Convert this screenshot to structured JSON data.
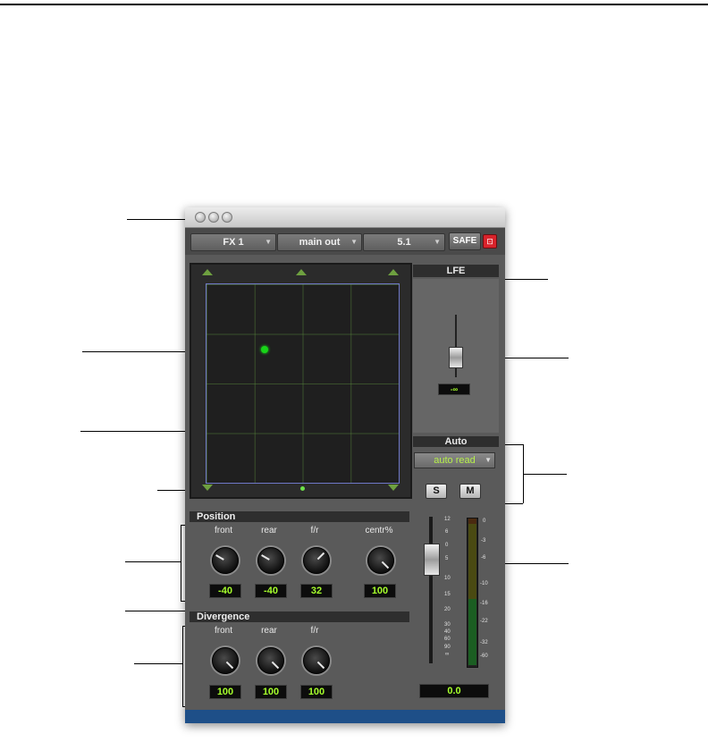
{
  "window": {
    "toolbar": {
      "insert_label": "FX 1",
      "output_label": "main out",
      "format_label": "5.1",
      "safe_label": "SAFE"
    },
    "lfe": {
      "header": "LFE",
      "value": "-∞"
    },
    "auto": {
      "header": "Auto",
      "mode": "auto read",
      "solo": "S",
      "mute": "M"
    },
    "position": {
      "header": "Position",
      "knobs": [
        {
          "label": "front",
          "value": "-40"
        },
        {
          "label": "rear",
          "value": "-40"
        },
        {
          "label": "f/r",
          "value": "32"
        },
        {
          "label": "centr%",
          "value": "100"
        }
      ]
    },
    "divergence": {
      "header": "Divergence",
      "knobs": [
        {
          "label": "front",
          "value": "100"
        },
        {
          "label": "rear",
          "value": "100"
        },
        {
          "label": "f/r",
          "value": "100"
        }
      ]
    },
    "fader": {
      "value": "0.0",
      "scale": [
        "12",
        "6",
        "0",
        "5",
        "10",
        "15",
        "20",
        "30",
        "40",
        "60",
        "90",
        "∞"
      ]
    },
    "meter": {
      "scale": [
        "0",
        "-3",
        "-6",
        "-10",
        "-16",
        "-22",
        "-32",
        "-60"
      ]
    },
    "colors": {
      "accent_green": "#a6ff2c",
      "close_red": "#d8232b",
      "bottom_bar": "#1e4f88"
    }
  }
}
